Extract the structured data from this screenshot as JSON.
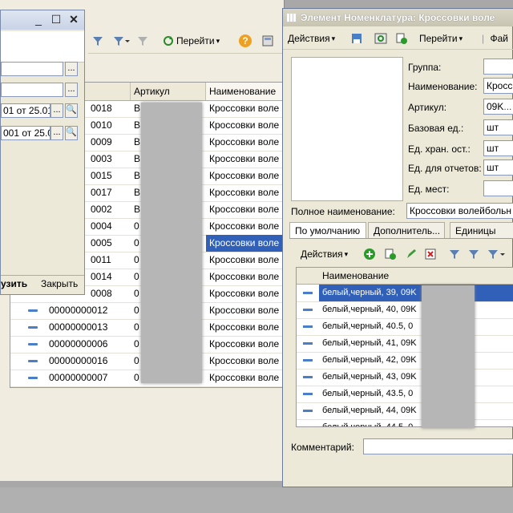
{
  "list_toolbar": {
    "goto_label": "Перейти",
    "help_icon": "?"
  },
  "list_grid": {
    "headers": {
      "artikul": "Артикул",
      "name": "Наименование"
    },
    "rows": [
      {
        "code": "0018",
        "art": "B",
        "name": "Кроссовки воле"
      },
      {
        "code": "0010",
        "art": "B",
        "name": "Кроссовки воле"
      },
      {
        "code": "0009",
        "art": "B",
        "name": "Кроссовки воле"
      },
      {
        "code": "0003",
        "art": "B",
        "name": "Кроссовки воле"
      },
      {
        "code": "0015",
        "art": "B",
        "name": "Кроссовки воле"
      },
      {
        "code": "0017",
        "art": "B",
        "name": "Кроссовки воле"
      },
      {
        "code": "0002",
        "art": "B",
        "name": "Кроссовки воле"
      },
      {
        "code": "0004",
        "art": "0",
        "name": "Кроссовки воле"
      },
      {
        "code": "0005",
        "art": "0",
        "name": "Кроссовки воле"
      },
      {
        "code": "0011",
        "art": "0",
        "name": "Кроссовки воле"
      },
      {
        "code": "0014",
        "art": "0",
        "name": "Кроссовки воле"
      },
      {
        "code": "0008",
        "art": "0",
        "name": "Кроссовки воле"
      },
      {
        "code": "00000000012",
        "art": "0",
        "name": "Кроссовки воле"
      },
      {
        "code": "00000000013",
        "art": "0",
        "name": "Кроссовки воле"
      },
      {
        "code": "00000000006",
        "art": "0",
        "name": "Кроссовки воле"
      },
      {
        "code": "00000000016",
        "art": "0",
        "name": "Кроссовки воле"
      },
      {
        "code": "00000000007",
        "art": "0",
        "name": "Кроссовки воле"
      }
    ]
  },
  "filter_dialog": {
    "date1": "01 от 25.01",
    "date2": "001 от 25.0",
    "load_label": "узить",
    "close_label": "Закрыть"
  },
  "element_window": {
    "title": "Элемент Номенклатура: Кроссовки воле",
    "toolbar": {
      "actions": "Действия",
      "goto": "Перейти",
      "file": "Фай"
    },
    "fields": {
      "group_label": "Группа:",
      "name_label": "Наименование:",
      "name_value": "Кросс",
      "artikul_label": "Артикул:",
      "artikul_value": "09K",
      "base_unit_label": "Базовая ед.:",
      "base_unit_value": "шт",
      "storage_unit_label": "Ед. хран. ост.:",
      "storage_unit_value": "шт",
      "report_unit_label": "Ед. для отчетов:",
      "report_unit_value": "шт",
      "places_label": "Ед. мест:",
      "full_name_label": "Полное наименование:",
      "full_name_value": "Кроссовки волейбольн"
    },
    "tabs": [
      "По умолчанию",
      "Дополнитель...",
      "Единицы"
    ],
    "inner_toolbar": {
      "actions": "Действия"
    },
    "inner_grid": {
      "header": "Наименование",
      "rows": [
        "белый,черный, 39, 09K",
        "белый,черный, 40, 09K",
        "белый,черный, 40.5, 0",
        "белый,черный, 41, 09K",
        "белый,черный, 42, 09K",
        "белый,черный, 43, 09K",
        "белый,черный, 43.5, 0",
        "белый,черный, 44, 09K",
        "белый,черный, 44.5, 0"
      ]
    },
    "comment_label": "Комментарий:"
  },
  "colors": {
    "selection": "#3160b8",
    "window_bg": "#ece9d8",
    "accent_icon": "#4a7fc8"
  }
}
